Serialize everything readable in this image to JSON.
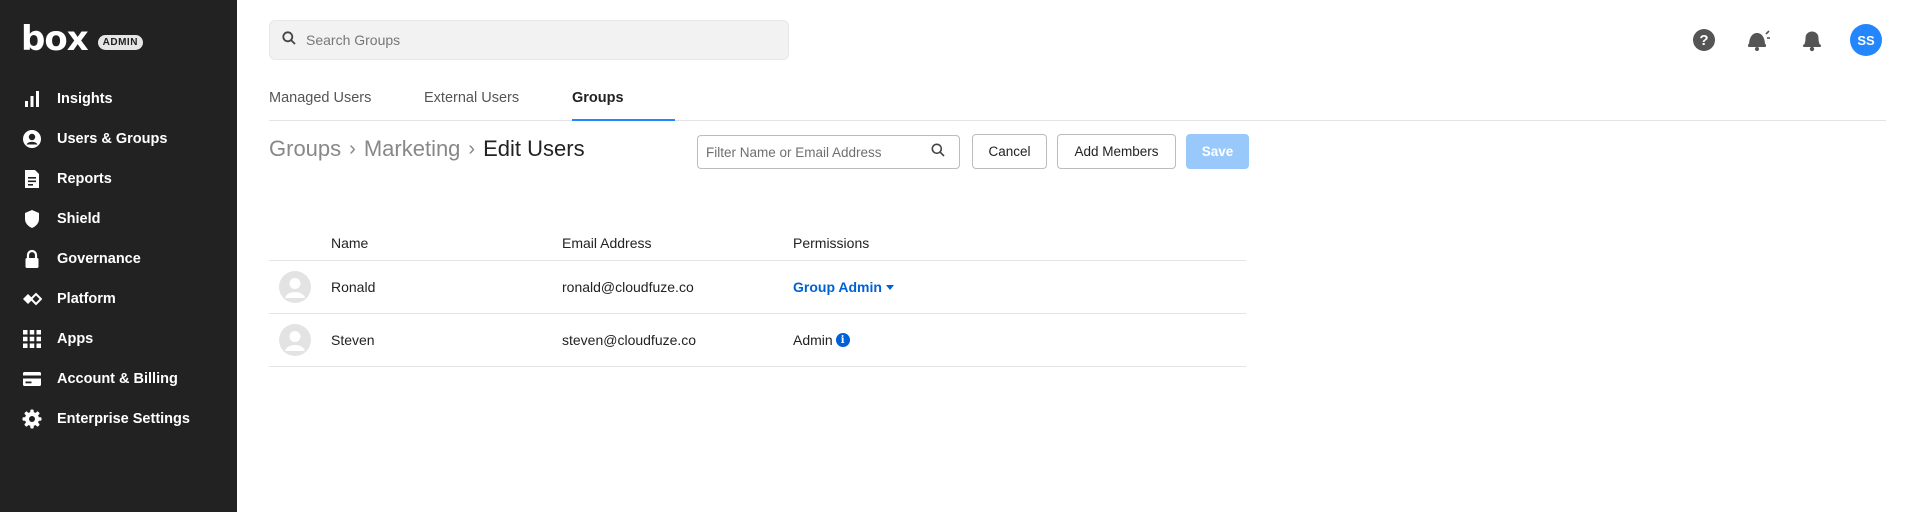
{
  "brand": {
    "logo": "box",
    "badge": "ADMIN"
  },
  "sidebar": {
    "items": [
      {
        "label": "Insights",
        "icon": "bar-chart-icon"
      },
      {
        "label": "Users & Groups",
        "icon": "user-circle-icon"
      },
      {
        "label": "Reports",
        "icon": "report-icon"
      },
      {
        "label": "Shield",
        "icon": "shield-icon"
      },
      {
        "label": "Governance",
        "icon": "lock-icon"
      },
      {
        "label": "Platform",
        "icon": "platform-icon"
      },
      {
        "label": "Apps",
        "icon": "grid-icon"
      },
      {
        "label": "Account & Billing",
        "icon": "billing-icon"
      },
      {
        "label": "Enterprise Settings",
        "icon": "gear-icon"
      }
    ]
  },
  "search": {
    "placeholder": "Search Groups"
  },
  "header": {
    "avatar_initials": "SS"
  },
  "tabs": [
    {
      "label": "Managed Users",
      "active": false
    },
    {
      "label": "External Users",
      "active": false
    },
    {
      "label": "Groups",
      "active": true
    }
  ],
  "breadcrumb": {
    "root": "Groups",
    "group": "Marketing",
    "current": "Edit Users"
  },
  "filter": {
    "placeholder": "Filter Name or Email Address"
  },
  "actions": {
    "cancel": "Cancel",
    "add_members": "Add Members",
    "save": "Save"
  },
  "table": {
    "columns": [
      "Name",
      "Email Address",
      "Permissions"
    ],
    "rows": [
      {
        "name": "Ronald",
        "email": "ronald@cloudfuze.co",
        "permission": "Group Admin"
      },
      {
        "name": "Steven",
        "email": "steven@cloudfuze.co",
        "permission": "Admin"
      }
    ]
  },
  "colors": {
    "sidebar_bg": "#222222",
    "accent": "#2486fc",
    "link": "#0061d5",
    "save_disabled": "#99c8fb"
  }
}
